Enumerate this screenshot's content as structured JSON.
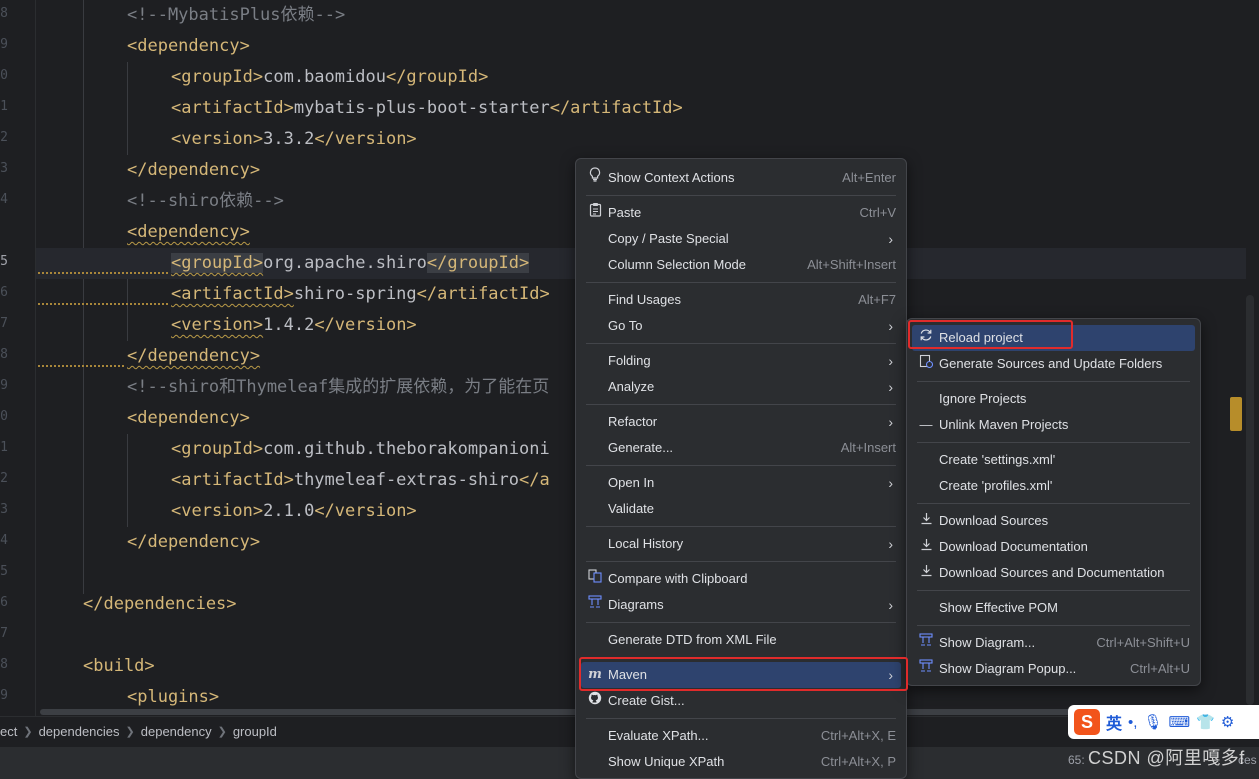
{
  "editor": {
    "line_numbers": [
      "8",
      "9",
      "0",
      "1",
      "2",
      "3",
      "4",
      "5",
      "6",
      "7",
      "8",
      "9",
      "0",
      "1",
      "2",
      "3",
      "4",
      "5",
      "6",
      "7",
      "8",
      "9"
    ],
    "lines": {
      "l01": {
        "c1": "<!--MybatisPlus依赖-->"
      },
      "l02": {
        "t1": "<dependency>"
      },
      "l03": {
        "t1": "<groupId>",
        "v": "com.baomidou",
        "t2": "</groupId>"
      },
      "l04": {
        "t1": "<artifactId>",
        "v": "mybatis-plus-boot-starter",
        "t2": "</artifactId>"
      },
      "l05": {
        "t1": "<version>",
        "v": "3.3.2",
        "t2": "</version>"
      },
      "l06": {
        "t1": "</dependency>"
      },
      "l07": {
        "c1": "<!--shiro依赖-->"
      },
      "l08": {
        "t1": "<dependency>"
      },
      "l09": {
        "t1": "<groupId>",
        "v": "org.apache.shiro",
        "t2": "</groupId>"
      },
      "l10": {
        "t1": "<artifactId>",
        "v": "shiro-spring",
        "t2": "</artifactId>"
      },
      "l11": {
        "t1": "<version>",
        "v": "1.4.2",
        "t2": "</version>"
      },
      "l12": {
        "t1": "</dependency>"
      },
      "l13": {
        "c1": "<!--shiro和Thymeleaf集成的扩展依赖，为了能在页"
      },
      "l14": {
        "t1": "<dependency>"
      },
      "l15": {
        "t1": "<groupId>",
        "v": "com.github.theborakompanioni"
      },
      "l16": {
        "t1": "<artifactId>",
        "v": "thymeleaf-extras-shiro",
        "t2": "</a"
      },
      "l17": {
        "t1": "<version>",
        "v": "2.1.0",
        "t2": "</version>"
      },
      "l18": {
        "t1": "</dependency>"
      },
      "l19": {},
      "l20": {
        "t1": "</dependencies>"
      },
      "l21": {},
      "l22": {
        "t1": "<build>"
      },
      "l23": {
        "t1": "<plugins>"
      }
    }
  },
  "breadcrumb": [
    "ect",
    "dependencies",
    "dependency",
    "groupId"
  ],
  "status": {
    "position": "65:",
    "encoding": "ces"
  },
  "watermark": "CSDN @阿里嘎多f",
  "ime": {
    "logo": "S",
    "lang": "英",
    "punct": "•,",
    "mic": "🎙",
    "kbd": "⌨",
    "shirt": "👕",
    "tool": "⚙"
  },
  "context_menu": {
    "items": [
      {
        "label": "Show Context Actions",
        "shortcut": "Alt+Enter",
        "icon": "bulb-icon"
      },
      {
        "label": "Paste",
        "shortcut": "Ctrl+V",
        "icon": "clipboard-icon"
      },
      {
        "label": "Copy / Paste Special"
      },
      {
        "label": "Column Selection Mode",
        "shortcut": "Alt+Shift+Insert"
      },
      {
        "label": "Find Usages",
        "shortcut": "Alt+F7"
      },
      {
        "label": "Go To"
      },
      {
        "label": "Folding"
      },
      {
        "label": "Analyze"
      },
      {
        "label": "Refactor"
      },
      {
        "label": "Generate...",
        "shortcut": "Alt+Insert"
      },
      {
        "label": "Open In"
      },
      {
        "label": "Validate"
      },
      {
        "label": "Local History"
      },
      {
        "label": "Compare with Clipboard",
        "icon": "compare-icon"
      },
      {
        "label": "Diagrams",
        "icon": "diagram-icon"
      },
      {
        "label": "Generate DTD from XML File"
      },
      {
        "label": "Maven",
        "icon": "maven-icon"
      },
      {
        "label": "Create Gist...",
        "icon": "github-icon"
      },
      {
        "label": "Evaluate XPath...",
        "shortcut": "Ctrl+Alt+X, E"
      },
      {
        "label": "Show Unique XPath",
        "shortcut": "Ctrl+Alt+X, P"
      }
    ]
  },
  "maven_menu": {
    "items": [
      {
        "label": "Reload project",
        "icon": "reload-icon"
      },
      {
        "label": "Generate Sources and Update Folders",
        "icon": "generate-sources-icon"
      },
      {
        "label": "Ignore Projects"
      },
      {
        "label": "Unlink Maven Projects",
        "icon": "minus-icon"
      },
      {
        "label": "Create 'settings.xml'"
      },
      {
        "label": "Create 'profiles.xml'"
      },
      {
        "label": "Download Sources",
        "icon": "download-icon"
      },
      {
        "label": "Download Documentation",
        "icon": "download-icon"
      },
      {
        "label": "Download Sources and Documentation",
        "icon": "download-icon"
      },
      {
        "label": "Show Effective POM"
      },
      {
        "label": "Show Diagram...",
        "shortcut": "Ctrl+Alt+Shift+U",
        "icon": "diagram-icon"
      },
      {
        "label": "Show Diagram Popup...",
        "shortcut": "Ctrl+Alt+U",
        "icon": "diagram-icon"
      }
    ]
  },
  "colors": {
    "accent_selection": "#2e436e",
    "annotation_red": "#e02b2b",
    "xml_tag": "#d5b778",
    "comment": "#7a7e85"
  }
}
